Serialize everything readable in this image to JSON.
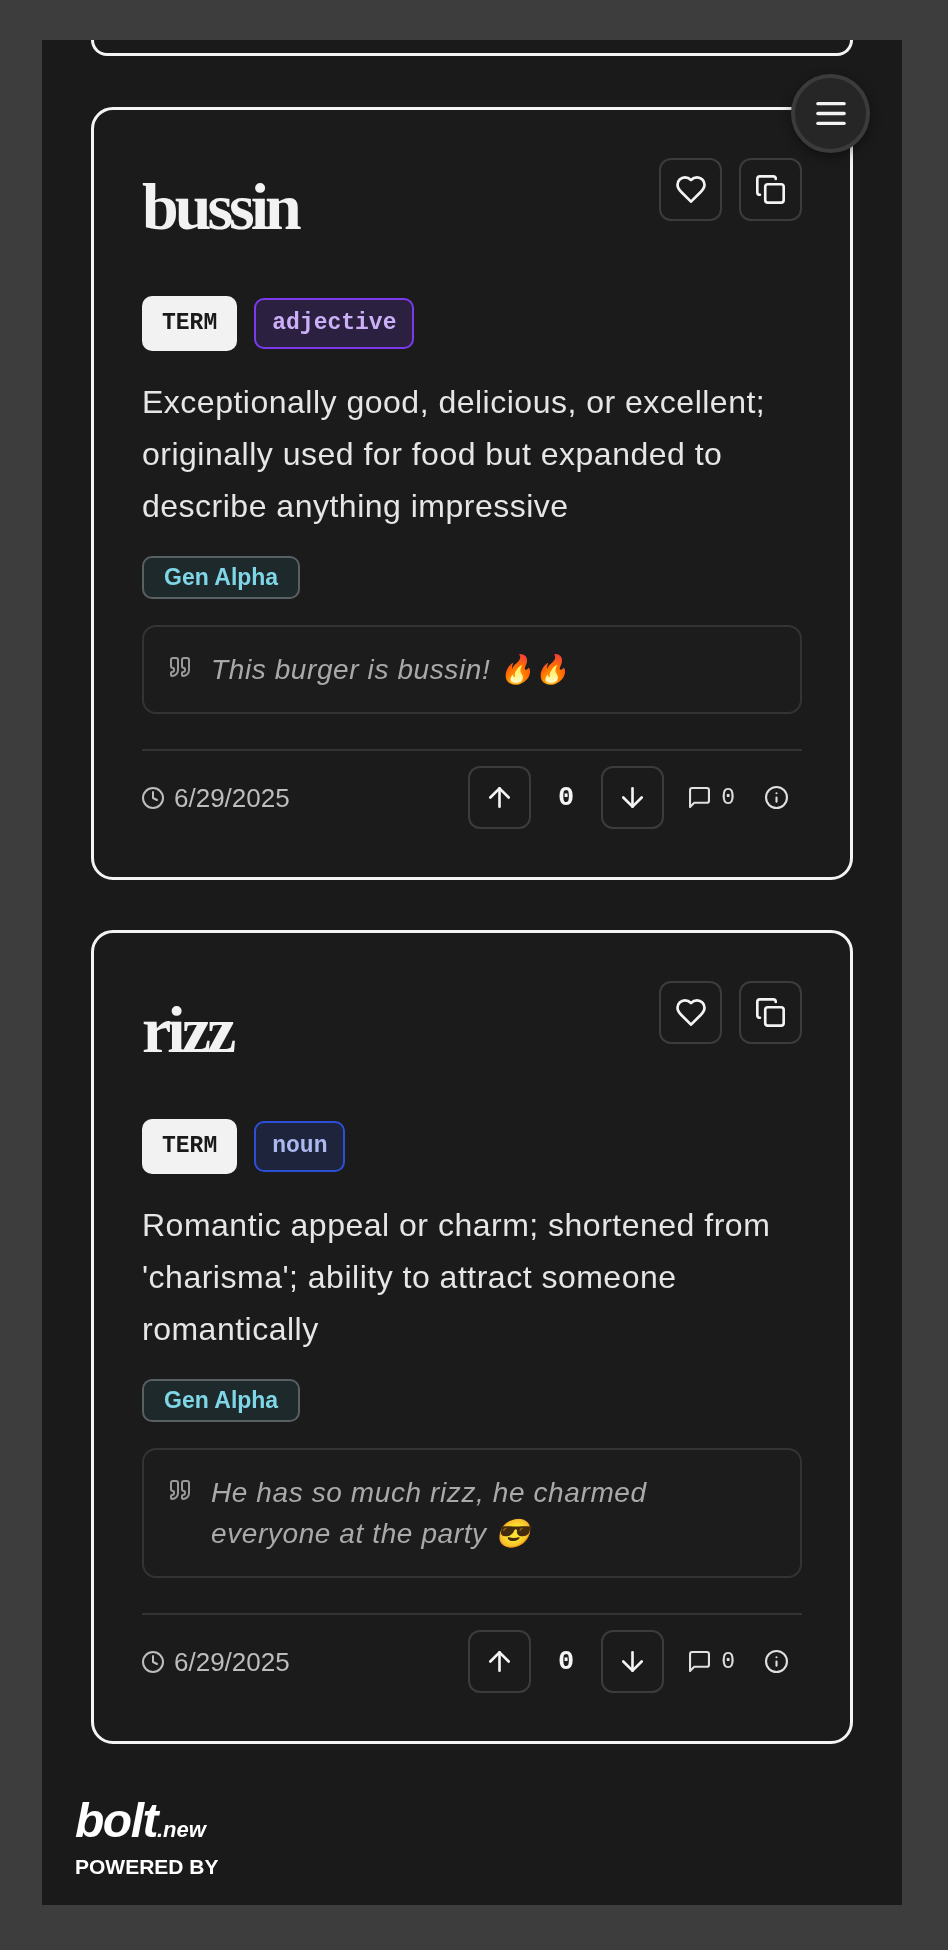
{
  "entries": [
    {
      "term": "bussin",
      "badge": "TERM",
      "part_of_speech": {
        "label": "adjective",
        "color": "#7c3aed"
      },
      "definition": "Exceptionally good, delicious, or excellent; originally used for food but expanded to describe anything impressive",
      "generation": "Gen Alpha",
      "example": "This burger is bussin! 🔥🔥",
      "date": "6/29/2025",
      "score": "0",
      "comments": "0"
    },
    {
      "term": "rizz",
      "badge": "TERM",
      "part_of_speech": {
        "label": "noun",
        "color": "#2c4fd8"
      },
      "definition": "Romantic appeal or charm; shortened from 'charisma'; ability to attract someone romantically",
      "generation": "Gen Alpha",
      "example": "He has so much rizz, he charmed everyone at the party 😎",
      "date": "6/29/2025",
      "score": "0",
      "comments": "0"
    }
  ],
  "powered_by": {
    "logo": "bolt",
    "logo_suffix": ".new",
    "caption": "POWERED BY"
  }
}
